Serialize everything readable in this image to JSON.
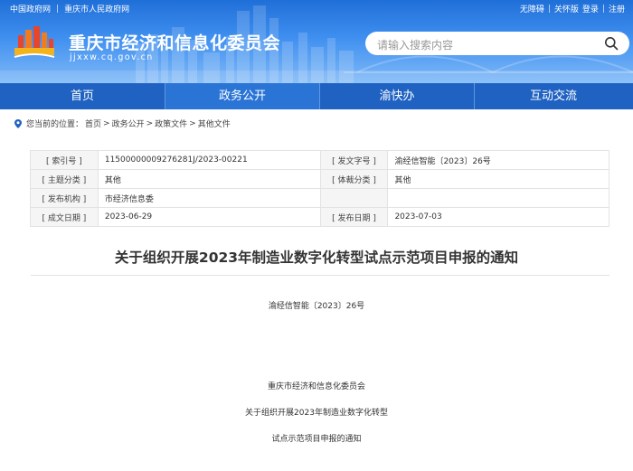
{
  "topbar": {
    "links_left": [
      "中国政府网",
      "重庆市人民政府网"
    ],
    "links_right": [
      "无障碍",
      "关怀版",
      "登录",
      "注册"
    ]
  },
  "header": {
    "site_title": "重庆市经济和信息化委员会",
    "site_domain": "jjxxw.cq.gov.cn",
    "search_placeholder": "请输入搜索内容"
  },
  "nav": {
    "items": [
      {
        "label": "首页",
        "active": false
      },
      {
        "label": "政务公开",
        "active": true
      },
      {
        "label": "渝快办",
        "active": false
      },
      {
        "label": "互动交流",
        "active": false
      }
    ]
  },
  "breadcrumb": {
    "prefix": "您当前的位置：",
    "items": [
      "首页",
      "政务公开",
      "政策文件",
      "其他文件"
    ],
    "separator": ">"
  },
  "info": {
    "rows": [
      {
        "k1": "[ 索引号 ]",
        "v1": "11500000009276281J/2023-00221",
        "k2": "[ 发文字号 ]",
        "v2": "渝经信智能〔2023〕26号"
      },
      {
        "k1": "[ 主题分类 ]",
        "v1": "其他",
        "k2": "[ 体裁分类 ]",
        "v2": "其他"
      },
      {
        "k1": "[ 发布机构 ]",
        "v1": "市经济信息委",
        "k2": "",
        "v2": ""
      },
      {
        "k1": "[ 成文日期 ]",
        "v1": "2023-06-29",
        "k2": "[ 发布日期 ]",
        "v2": "2023-07-03"
      }
    ]
  },
  "article": {
    "title": "关于组织开展2023年制造业数字化转型试点示范项目申报的通知",
    "doc_number": "渝经信智能〔2023〕26号",
    "body": [
      "重庆市经济和信息化委员会",
      "关于组织开展2023年制造业数字化转型",
      "试点示范项目申报的通知"
    ]
  },
  "colors": {
    "nav_bg": "#1f62c2",
    "nav_active": "#2a74d6",
    "header_gradient_top": "#1f6fd8"
  }
}
